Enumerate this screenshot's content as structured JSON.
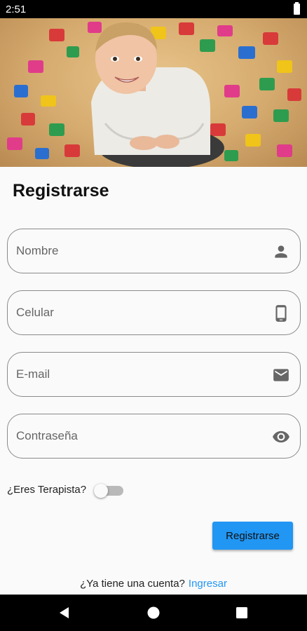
{
  "status_bar": {
    "time": "2:51"
  },
  "hero": {
    "icon": "child-with-puzzle-pieces-photo"
  },
  "form": {
    "title": "Registrarse",
    "fields": [
      {
        "placeholder": "Nombre",
        "icon": "person-icon"
      },
      {
        "placeholder": "Celular",
        "icon": "phone-icon"
      },
      {
        "placeholder": "E-mail",
        "icon": "mail-icon"
      },
      {
        "placeholder": "Contraseña",
        "icon": "eye-icon"
      }
    ],
    "therapist_toggle": {
      "label": "¿Eres Terapista?",
      "on": false
    },
    "submit_label": "Registrarse"
  },
  "footer": {
    "question": "¿Ya tiene una cuenta?",
    "login_link": "Ingresar"
  },
  "colors": {
    "accent": "#2196f3",
    "background": "#fafafa",
    "field_border": "#8a8a8a"
  }
}
